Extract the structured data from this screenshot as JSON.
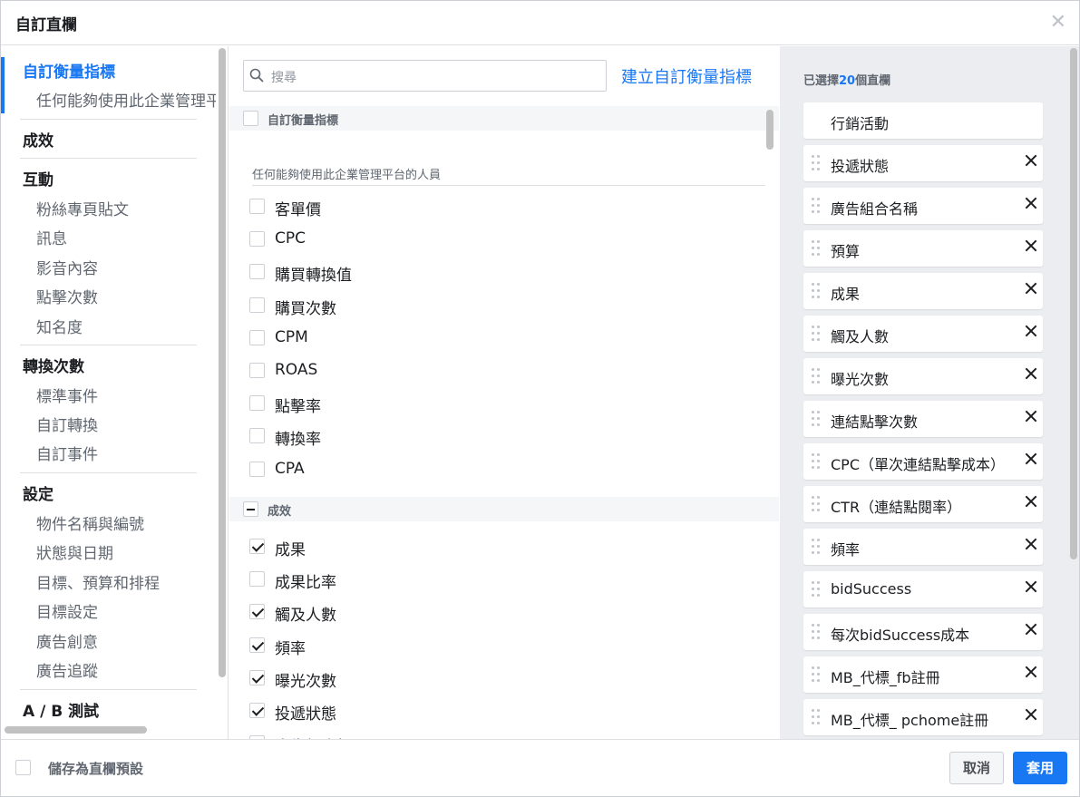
{
  "dialog": {
    "title": "自訂直欄"
  },
  "leftnav": {
    "items": [
      {
        "label": "自訂衡量指標",
        "kind": "head",
        "active": true
      },
      {
        "label": "任何能夠使用此企業管理平台的人員",
        "kind": "sub"
      },
      {
        "label": "成效",
        "kind": "head"
      },
      {
        "label": "互動",
        "kind": "head"
      },
      {
        "label": "粉絲專頁貼文",
        "kind": "sub"
      },
      {
        "label": "訊息",
        "kind": "sub"
      },
      {
        "label": "影音內容",
        "kind": "sub"
      },
      {
        "label": "點擊次數",
        "kind": "sub"
      },
      {
        "label": "知名度",
        "kind": "sub"
      },
      {
        "label": "轉換次數",
        "kind": "head"
      },
      {
        "label": "標準事件",
        "kind": "sub"
      },
      {
        "label": "自訂轉換",
        "kind": "sub"
      },
      {
        "label": "自訂事件",
        "kind": "sub"
      },
      {
        "label": "設定",
        "kind": "head"
      },
      {
        "label": "物件名稱與編號",
        "kind": "sub"
      },
      {
        "label": "狀態與日期",
        "kind": "sub"
      },
      {
        "label": "目標、預算和排程",
        "kind": "sub"
      },
      {
        "label": "目標設定",
        "kind": "sub"
      },
      {
        "label": "廣告創意",
        "kind": "sub"
      },
      {
        "label": "廣告追蹤",
        "kind": "sub"
      },
      {
        "label": "A / B 測試",
        "kind": "head"
      }
    ]
  },
  "middle": {
    "search_placeholder": "搜尋",
    "create_link": "建立自訂衡量指標",
    "section_custom": "自訂衡量指標",
    "sub_heading": "任何能夠使用此企業管理平台的人員",
    "custom_metrics": [
      {
        "label": "客單價",
        "checked": false
      },
      {
        "label": "CPC",
        "checked": false
      },
      {
        "label": "購買轉換值",
        "checked": false
      },
      {
        "label": "購買次數",
        "checked": false
      },
      {
        "label": "CPM",
        "checked": false
      },
      {
        "label": "ROAS",
        "checked": false
      },
      {
        "label": "點擊率",
        "checked": false
      },
      {
        "label": "轉換率",
        "checked": false
      },
      {
        "label": "CPA",
        "checked": false
      }
    ],
    "section_performance": "成效",
    "performance_metrics": [
      {
        "label": "成果",
        "checked": true
      },
      {
        "label": "成果比率",
        "checked": false
      },
      {
        "label": "觸及人數",
        "checked": true
      },
      {
        "label": "頻率",
        "checked": true
      },
      {
        "label": "曝光次數",
        "checked": true
      },
      {
        "label": "投遞狀態",
        "checked": true
      },
      {
        "label": "廣告組合相關",
        "checked": false
      }
    ]
  },
  "right": {
    "selected_prefix": "已選擇",
    "selected_count": "20",
    "selected_suffix": "個直欄",
    "columns": [
      {
        "label": "行銷活動",
        "fixed": true
      },
      {
        "label": "投遞狀態"
      },
      {
        "label": "廣告組合名稱"
      },
      {
        "label": "預算"
      },
      {
        "label": "成果"
      },
      {
        "label": "觸及人數"
      },
      {
        "label": "曝光次數"
      },
      {
        "label": "連結點擊次數"
      },
      {
        "label": "CPC（單次連結點擊成本）"
      },
      {
        "label": "CTR（連結點閱率）"
      },
      {
        "label": "頻率"
      },
      {
        "label": "bidSuccess"
      },
      {
        "label": "每次bidSuccess成本"
      },
      {
        "label": "MB_代標_fb註冊"
      },
      {
        "label": "MB_代標_ pchome註冊"
      }
    ]
  },
  "footer": {
    "save_preset": "儲存為直欄預設",
    "cancel": "取消",
    "apply": "套用"
  }
}
